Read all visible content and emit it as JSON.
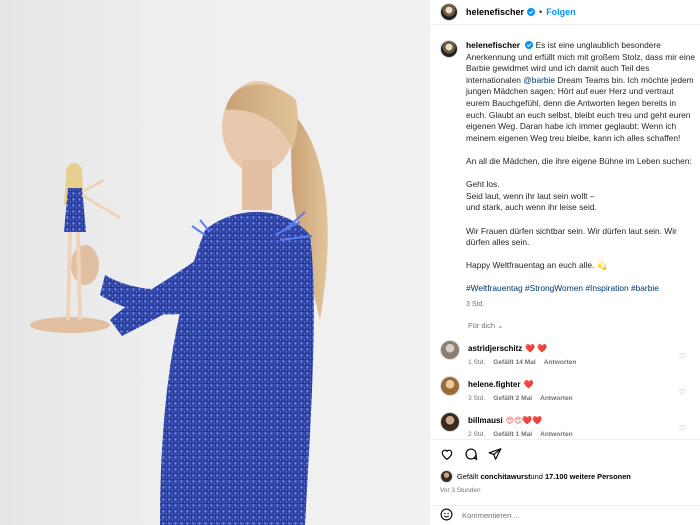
{
  "post": {
    "username": "helenefischer",
    "verified": true,
    "separator": "•",
    "follow_label": "Folgen"
  },
  "caption": {
    "p1_before": "Es ist eine unglaublich besondere Anerkennung und erfüllt mich mit großem Stolz, dass mir eine Barbie gewidmet wird und ich damit auch Teil des internationalen ",
    "mention": "@barbie",
    "p1_after": " Dream Teams bin. Ich möchte jedem jungen Mädchen sagen: Hört auf euer Herz und vertraut eurem Bauchgefühl, denn die Antworten liegen bereits in euch. Glaubt an euch selbst, bleibt euch treu und geht euren eigenen Weg. Daran habe ich immer geglaubt: Wenn ich meinem eigenen Weg treu bleibe, kann ich alles schaffen!",
    "p2": "An all die Mädchen, die ihre eigene Bühne im Leben suchen:",
    "p3": "Geht los.\nSeid laut, wenn ihr laut sein wollt –\nund stark, auch wenn ihr leise seid.",
    "p4": "Wir Frauen dürfen sichtbar sein. Wir dürfen laut sein. Wir dürfen alles sein.",
    "p5": "Happy Weltfrauentag an euch alle. 💫",
    "hashtags": "#Weltfrauentag #StrongWomen #Inspiration #barbie",
    "time": "3 Std."
  },
  "translate_label": "Für dich",
  "comments": [
    {
      "user": "astridjerschitz",
      "emoji": "❤️ ❤️",
      "time": "1 Std.",
      "likes": "Gefällt 14 Mal",
      "reply": "Antworten",
      "avatar_color": "#b9b2a8"
    },
    {
      "user": "helene.fighter",
      "emoji": "❤️",
      "time": "3 Std.",
      "likes": "Gefällt 2 Mal",
      "reply": "Antworten",
      "avatar_color": "#c9a87c"
    },
    {
      "user": "billmausi",
      "emoji": "😍😍❤️❤️",
      "time": "2 Std.",
      "likes": "Gefällt 1 Mal",
      "reply": "Antworten",
      "avatar_color": "#6b5444"
    }
  ],
  "likes": {
    "prefix": "Gefällt ",
    "user": "conchitawurst",
    "middle": " und ",
    "count": "17.100 weitere Personen"
  },
  "posted_ago": "Vor 3 Stunden",
  "comment_input": {
    "placeholder": "Kommentieren ..."
  },
  "icons": [
    "heart-icon",
    "comment-icon",
    "share-icon",
    "smiley-icon",
    "verified-icon",
    "chevron-down-icon"
  ],
  "colors": {
    "accent": "#0095f6",
    "link": "#00376b",
    "dress": "#3a4fb0",
    "heart": "#ed4956"
  }
}
